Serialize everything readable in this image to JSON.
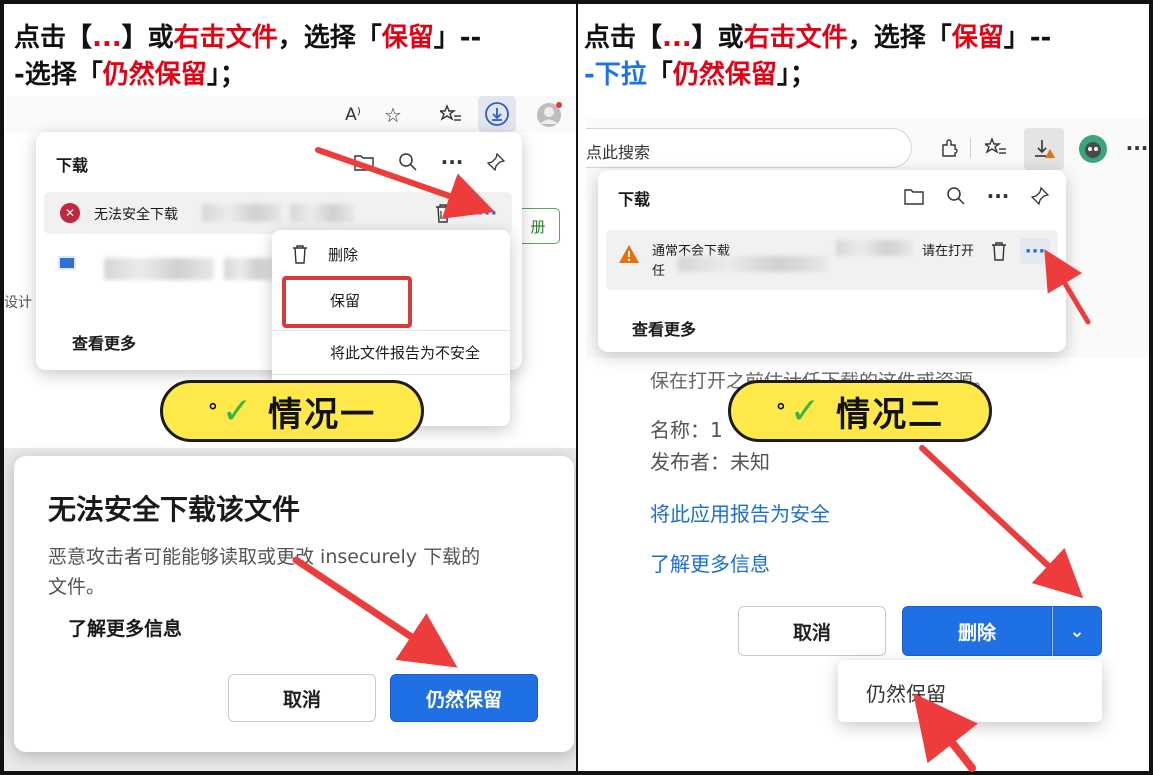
{
  "left": {
    "title_line1": [
      "点击【",
      "...",
      "】或",
      "右击文件",
      "，选择「",
      "保留",
      "」--"
    ],
    "title_line2": [
      "-选择「",
      "仍然保留",
      "」；"
    ],
    "toolbar": {
      "read_aloud": "A⁾"
    },
    "downloads": {
      "header": "下载",
      "item_error_text": "无法安全下载",
      "more_label": "···",
      "see_more": "查看更多",
      "side_text": "设计",
      "side_button": "册"
    },
    "context_menu": {
      "delete": "删除",
      "keep": "保留",
      "report": "将此文件报告为不安全"
    },
    "badge": "情况一",
    "dialog": {
      "title": "无法安全下载该文件",
      "body_line1": "恶意攻击者可能能够读取或更改 insecurely 下载的",
      "body_line2": "文件。",
      "learn_more": "了解更多信息",
      "cancel": "取消",
      "keep_anyway": "仍然保留"
    }
  },
  "right": {
    "title_line1": [
      "点击【",
      "...",
      "】或",
      "右击文件",
      "，选择「",
      "保留",
      "」--"
    ],
    "title_line2_blue": "-下拉",
    "title_line2": [
      "「",
      "仍然保留",
      "」；"
    ],
    "search_placeholder": "点此搜索",
    "downloads": {
      "header": "下载",
      "item_text_line1": "通常不会下载",
      "item_text_line2": "任",
      "item_right_text": "请在打开",
      "more_label": "···",
      "see_more": "查看更多"
    },
    "badge": "情况二",
    "page": {
      "partial_text": "保在打开之前估计任下载的这件或资源。",
      "name_label": "名称：1",
      "publisher_label": "发布者：未知",
      "report_safe_link": "将此应用报告为安全",
      "learn_more_link": "了解更多信息"
    },
    "buttons": {
      "cancel": "取消",
      "delete": "删除",
      "chevron": "⌄"
    },
    "dropdown": {
      "keep_anyway": "仍然保留"
    }
  },
  "colors": {
    "accent_red": "#e60012",
    "accent_blue": "#1a73e8",
    "badge_yellow": "#ffe94a",
    "primary_button": "#1f6fe5"
  }
}
